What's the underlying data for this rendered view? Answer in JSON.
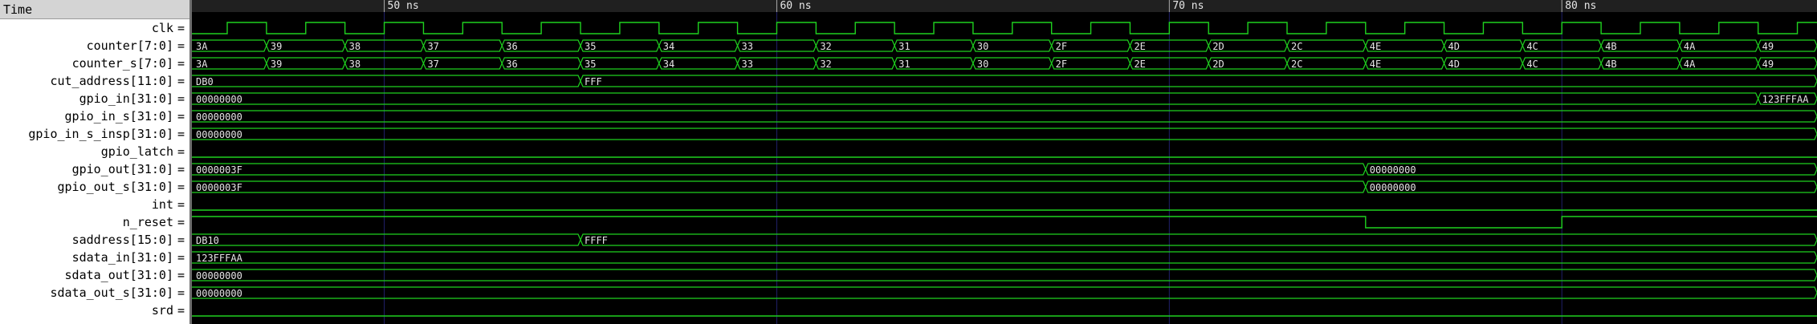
{
  "names_header": "Time",
  "timeline": {
    "major_labels": [
      "50 ns",
      "60 ns",
      "70 ns",
      "80 ns"
    ],
    "major_times_ns": [
      50,
      60,
      70,
      80
    ],
    "view_start_ns": 45.1,
    "view_end_ns": 86.5
  },
  "colors": {
    "background": "#000000",
    "wave": "#1fd11f",
    "text": "#e6e6e6",
    "grid": "#20206a",
    "names_panel": "#ffffff",
    "ruler": "#202020"
  },
  "signals": [
    {
      "name": "clk[=]",
      "label": "clk",
      "type": "bit",
      "segments": [
        {
          "t": 45.1,
          "v": 0
        },
        {
          "t": 46,
          "v": 1
        },
        {
          "t": 47,
          "v": 0
        },
        {
          "t": 48,
          "v": 1
        },
        {
          "t": 49,
          "v": 0
        },
        {
          "t": 50,
          "v": 1
        },
        {
          "t": 51,
          "v": 0
        },
        {
          "t": 52,
          "v": 1
        },
        {
          "t": 53,
          "v": 0
        },
        {
          "t": 54,
          "v": 1
        },
        {
          "t": 55,
          "v": 0
        },
        {
          "t": 56,
          "v": 1
        },
        {
          "t": 57,
          "v": 0
        },
        {
          "t": 58,
          "v": 1
        },
        {
          "t": 59,
          "v": 0
        },
        {
          "t": 60,
          "v": 1
        },
        {
          "t": 61,
          "v": 0
        },
        {
          "t": 62,
          "v": 1
        },
        {
          "t": 63,
          "v": 0
        },
        {
          "t": 64,
          "v": 1
        },
        {
          "t": 65,
          "v": 0
        },
        {
          "t": 66,
          "v": 1
        },
        {
          "t": 67,
          "v": 0
        },
        {
          "t": 68,
          "v": 1
        },
        {
          "t": 69,
          "v": 0
        },
        {
          "t": 70,
          "v": 1
        },
        {
          "t": 71,
          "v": 0
        },
        {
          "t": 72,
          "v": 1
        },
        {
          "t": 73,
          "v": 0
        },
        {
          "t": 74,
          "v": 1
        },
        {
          "t": 75,
          "v": 0
        },
        {
          "t": 76,
          "v": 1
        },
        {
          "t": 77,
          "v": 0
        },
        {
          "t": 78,
          "v": 1
        },
        {
          "t": 79,
          "v": 0
        },
        {
          "t": 80,
          "v": 1
        },
        {
          "t": 81,
          "v": 0
        },
        {
          "t": 82,
          "v": 1
        },
        {
          "t": 83,
          "v": 0
        },
        {
          "t": 84,
          "v": 1
        },
        {
          "t": 85,
          "v": 0
        },
        {
          "t": 86,
          "v": 1
        }
      ]
    },
    {
      "name": "counter[7:0]",
      "type": "bus",
      "segments": [
        {
          "t": 45.1,
          "v": "3A"
        },
        {
          "t": 47,
          "v": "39"
        },
        {
          "t": 49,
          "v": "38"
        },
        {
          "t": 51,
          "v": "37"
        },
        {
          "t": 53,
          "v": "36"
        },
        {
          "t": 55,
          "v": "35"
        },
        {
          "t": 57,
          "v": "34"
        },
        {
          "t": 59,
          "v": "33"
        },
        {
          "t": 61,
          "v": "32"
        },
        {
          "t": 63,
          "v": "31"
        },
        {
          "t": 65,
          "v": "30"
        },
        {
          "t": 67,
          "v": "2F"
        },
        {
          "t": 69,
          "v": "2E"
        },
        {
          "t": 71,
          "v": "2D"
        },
        {
          "t": 73,
          "v": "2C"
        },
        {
          "t": 75,
          "v": "4E"
        },
        {
          "t": 77,
          "v": "4D"
        },
        {
          "t": 79,
          "v": "4C"
        },
        {
          "t": 81,
          "v": "4B"
        },
        {
          "t": 83,
          "v": "4A"
        },
        {
          "t": 85,
          "v": "49"
        }
      ]
    },
    {
      "name": "counter_s[7:0]",
      "type": "bus",
      "segments": [
        {
          "t": 45.1,
          "v": "3A"
        },
        {
          "t": 47,
          "v": "39"
        },
        {
          "t": 49,
          "v": "38"
        },
        {
          "t": 51,
          "v": "37"
        },
        {
          "t": 53,
          "v": "36"
        },
        {
          "t": 55,
          "v": "35"
        },
        {
          "t": 57,
          "v": "34"
        },
        {
          "t": 59,
          "v": "33"
        },
        {
          "t": 61,
          "v": "32"
        },
        {
          "t": 63,
          "v": "31"
        },
        {
          "t": 65,
          "v": "30"
        },
        {
          "t": 67,
          "v": "2F"
        },
        {
          "t": 69,
          "v": "2E"
        },
        {
          "t": 71,
          "v": "2D"
        },
        {
          "t": 73,
          "v": "2C"
        },
        {
          "t": 75,
          "v": "4E"
        },
        {
          "t": 77,
          "v": "4D"
        },
        {
          "t": 79,
          "v": "4C"
        },
        {
          "t": 81,
          "v": "4B"
        },
        {
          "t": 83,
          "v": "4A"
        },
        {
          "t": 85,
          "v": "49"
        }
      ]
    },
    {
      "name": "cut_address[11:0]",
      "type": "bus",
      "segments": [
        {
          "t": 45.1,
          "v": "DB0"
        },
        {
          "t": 55,
          "v": "FFF"
        }
      ]
    },
    {
      "name": "gpio_in[31:0]",
      "type": "bus",
      "segments": [
        {
          "t": 45.1,
          "v": "00000000"
        },
        {
          "t": 85,
          "v": "123FFFAA"
        }
      ]
    },
    {
      "name": "gpio_in_s[31:0]",
      "type": "bus",
      "segments": [
        {
          "t": 45.1,
          "v": "00000000"
        }
      ]
    },
    {
      "name": "gpio_in_s_insp[31:0]",
      "type": "bus",
      "segments": [
        {
          "t": 45.1,
          "v": "00000000"
        }
      ]
    },
    {
      "name": "gpio_latch",
      "type": "bit",
      "segments": [
        {
          "t": 45.1,
          "v": 0
        }
      ]
    },
    {
      "name": "gpio_out[31:0]",
      "type": "bus",
      "segments": [
        {
          "t": 45.1,
          "v": "0000003F"
        },
        {
          "t": 75,
          "v": "00000000"
        }
      ]
    },
    {
      "name": "gpio_out_s[31:0]",
      "type": "bus",
      "segments": [
        {
          "t": 45.1,
          "v": "0000003F"
        },
        {
          "t": 75,
          "v": "00000000"
        }
      ]
    },
    {
      "name": "int",
      "type": "bit",
      "segments": [
        {
          "t": 45.1,
          "v": 0
        }
      ]
    },
    {
      "name": "n_reset",
      "type": "bit",
      "segments": [
        {
          "t": 45.1,
          "v": 1
        },
        {
          "t": 75,
          "v": 0
        },
        {
          "t": 80,
          "v": 1
        }
      ]
    },
    {
      "name": "saddress[15:0]",
      "type": "bus",
      "segments": [
        {
          "t": 45.1,
          "v": "DB10"
        },
        {
          "t": 55,
          "v": "FFFF"
        }
      ]
    },
    {
      "name": "sdata_in[31:0]",
      "type": "bus",
      "segments": [
        {
          "t": 45.1,
          "v": "123FFFAA"
        }
      ]
    },
    {
      "name": "sdata_out[31:0]",
      "type": "bus",
      "segments": [
        {
          "t": 45.1,
          "v": "00000000"
        }
      ]
    },
    {
      "name": "sdata_out_s[31:0]",
      "type": "bus",
      "segments": [
        {
          "t": 45.1,
          "v": "00000000"
        }
      ]
    },
    {
      "name": "srd",
      "type": "bit",
      "segments": [
        {
          "t": 45.1,
          "v": 0
        }
      ]
    }
  ]
}
